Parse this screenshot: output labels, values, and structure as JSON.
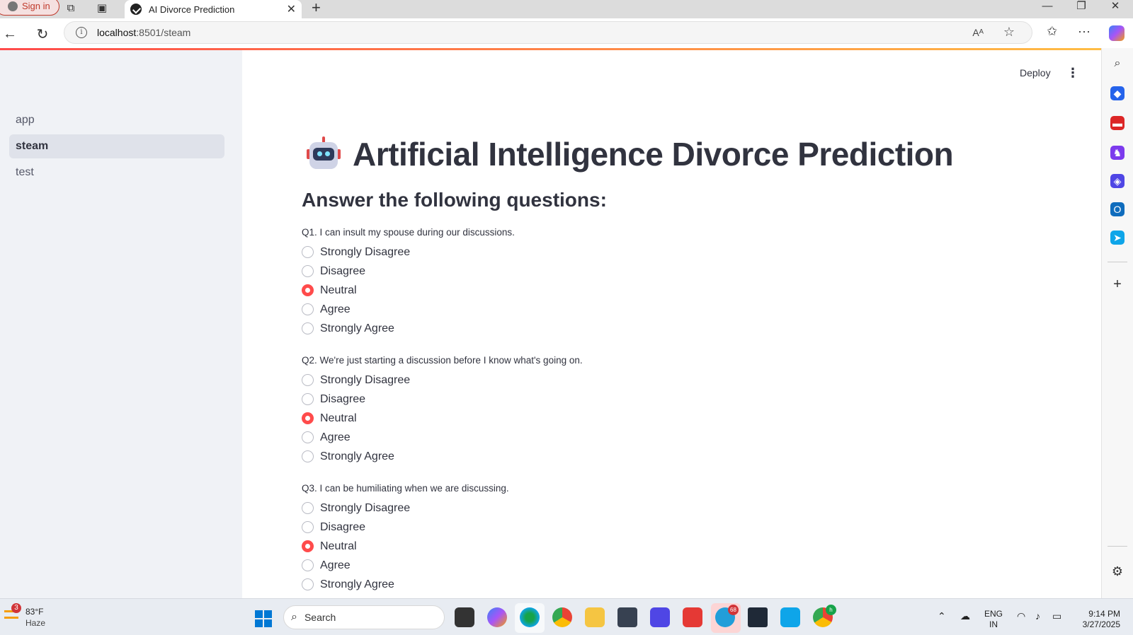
{
  "browser": {
    "signin_label": "Sign in",
    "tab_title": "AI Divorce Prediction",
    "url_host": "localhost",
    "url_path": ":8501/steam"
  },
  "sidebar": {
    "items": [
      {
        "label": "app",
        "active": false
      },
      {
        "label": "steam",
        "active": true
      },
      {
        "label": "test",
        "active": false
      }
    ]
  },
  "header": {
    "deploy_label": "Deploy"
  },
  "main": {
    "title": "Artificial Intelligence Divorce Prediction",
    "subtitle": "Answer the following questions:",
    "questions": [
      {
        "label": "Q1. I can insult my spouse during our discussions.",
        "options": [
          "Strongly Disagree",
          "Disagree",
          "Neutral",
          "Agree",
          "Strongly Agree"
        ],
        "selected": "Neutral"
      },
      {
        "label": "Q2. We're just starting a discussion before I know what's going on.",
        "options": [
          "Strongly Disagree",
          "Disagree",
          "Neutral",
          "Agree",
          "Strongly Agree"
        ],
        "selected": "Neutral"
      },
      {
        "label": "Q3. I can be humiliating when we are discussing.",
        "options": [
          "Strongly Disagree",
          "Disagree",
          "Neutral",
          "Agree",
          "Strongly Agree"
        ],
        "selected": "Neutral"
      }
    ]
  },
  "colors": {
    "accent": "#ff4b4b",
    "sidebar_bg": "#f0f2f6",
    "text": "#31333f"
  },
  "taskbar": {
    "weather_temp": "83°F",
    "weather_cond": "Haze",
    "weather_badge": "3",
    "search_label": "Search",
    "telegram_badge": "68",
    "chrome_badge": "h",
    "lang_line1": "ENG",
    "lang_line2": "IN",
    "time": "9:14 PM",
    "date": "3/27/2025"
  }
}
